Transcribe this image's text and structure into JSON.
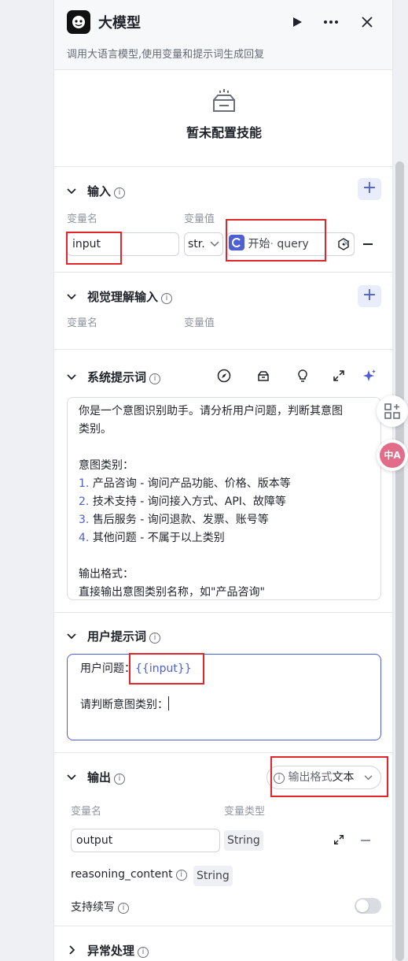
{
  "header": {
    "title": "大模型",
    "description": "调用大语言模型,使用变量和提示词生成回复"
  },
  "skill": {
    "empty_text": "暂未配置技能"
  },
  "input_section": {
    "title": "输入",
    "col_name": "变量名",
    "col_value": "变量值",
    "row": {
      "name": "input",
      "type": "str.",
      "ref_source": "开始",
      "ref_sep": "·",
      "ref_field": "query",
      "clear": "×"
    }
  },
  "vision_section": {
    "title": "视觉理解输入",
    "col_name": "变量名",
    "col_value": "变量值"
  },
  "system_prompt": {
    "title": "系统提示词",
    "lines": [
      "你是一个意图识别助手。请分析用户问题，判断其意图",
      "类别。",
      "",
      "意图类别：",
      "",
      "",
      "",
      "",
      "",
      "输出格式：",
      "直接输出意图类别名称，如\"产品咨询\""
    ],
    "numbered": [
      {
        "num": "1.",
        "text": "产品咨询 - 询问产品功能、价格、版本等"
      },
      {
        "num": "2.",
        "text": "技术支持 - 询问接入方式、API、故障等"
      },
      {
        "num": "3.",
        "text": "售后服务 - 询问退款、发票、账号等"
      },
      {
        "num": "4.",
        "text": "其他问题 - 不属于以上类别"
      }
    ]
  },
  "user_prompt": {
    "title": "用户提示词",
    "line1_prefix": "用户问题：",
    "line1_var": "{{input}}",
    "line2": "请判断意图类别："
  },
  "output_section": {
    "title": "输出",
    "format_label": "输出格式",
    "format_value": "文本",
    "col_name": "变量名",
    "col_type": "变量类型",
    "output_name": "output",
    "output_type": "String",
    "reasoning_name": "reasoning_content",
    "reasoning_type": "String",
    "continue_label": "支持续写"
  },
  "exception_section": {
    "title": "异常处理"
  },
  "colors": {
    "accent": "#4e5fd6",
    "highlight": "#e0262b"
  },
  "icons": [
    "bot-logo-icon",
    "play-icon",
    "more-icon",
    "close-icon",
    "empty-skill-icon",
    "info-icon",
    "plus-icon",
    "chevron-down-icon",
    "compass-icon",
    "library-icon",
    "bulb-icon",
    "expand-icon",
    "sparkle-icon",
    "node-ref-icon",
    "variable-icon",
    "minus-icon",
    "apps-icon",
    "translate-icon"
  ]
}
